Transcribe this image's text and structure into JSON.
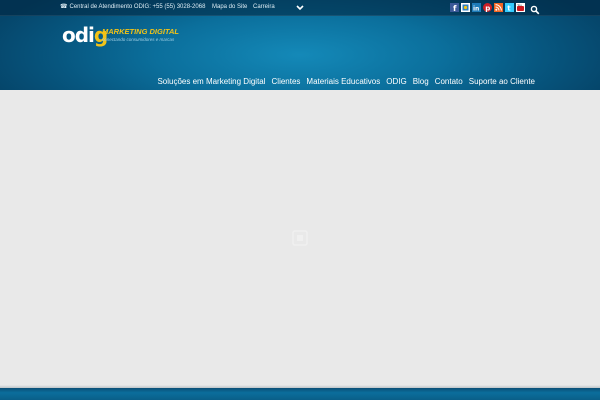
{
  "topbar": {
    "contact_icon": "phone-icon",
    "contact_text": "Central de Atendimento ODIG: +55 (55) 3028-2068",
    "links": [
      "Mapa do Site",
      "Carreira"
    ],
    "dropdown_icon": "chevron-down-icon",
    "social_icons": [
      "facebook-icon",
      "google-plus-icon",
      "linkedin-icon",
      "pinterest-icon",
      "rss-icon",
      "twitter-icon",
      "youtube-icon"
    ],
    "search_icon": "search-icon"
  },
  "logo": {
    "mark": "odig",
    "title": "MARKETING DIGITAL",
    "tagline": "conectando consumidores e marcas"
  },
  "nav": {
    "items": [
      "Soluções em Marketing Digital",
      "Clientes",
      "Materiais Educativos",
      "ODIG",
      "Blog",
      "Contato",
      "Suporte ao Cliente"
    ]
  },
  "colors": {
    "header_blue": "#0b6f9c",
    "accent_yellow": "#f2c318",
    "content_bg": "#e9e9e9"
  }
}
